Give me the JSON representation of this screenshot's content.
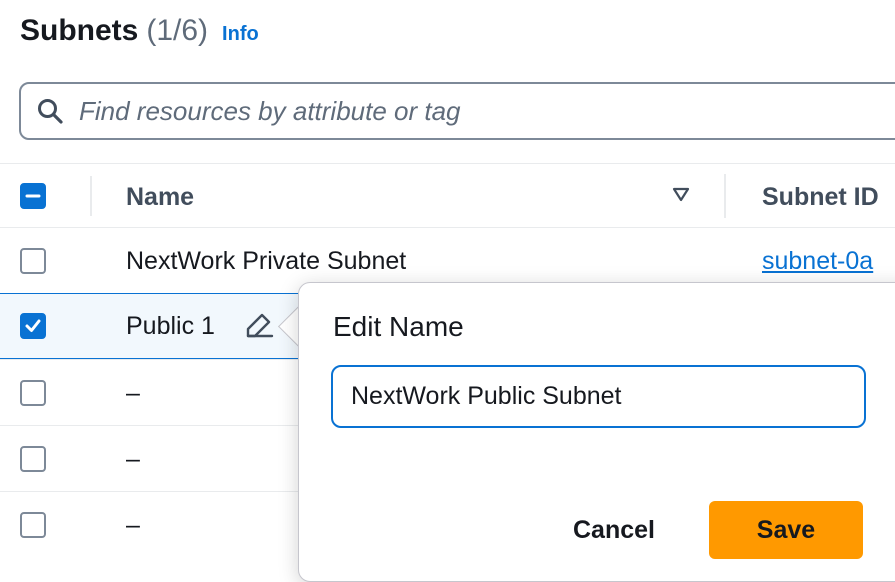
{
  "header": {
    "title": "Subnets",
    "count": "(1/6)",
    "info_link": "Info"
  },
  "search": {
    "placeholder": "Find resources by attribute or tag",
    "icon": "search-icon"
  },
  "table": {
    "columns": [
      "Name",
      "Subnet ID"
    ],
    "rows": [
      {
        "name": "NextWork Private Subnet",
        "subnet_id": "subnet-0a",
        "checked": false
      },
      {
        "name": "Public 1",
        "subnet_id": "",
        "checked": true
      },
      {
        "name": "–",
        "subnet_id": "",
        "checked": false
      },
      {
        "name": "–",
        "subnet_id": "",
        "checked": false
      },
      {
        "name": "–",
        "subnet_id": "",
        "checked": false
      }
    ]
  },
  "popover": {
    "title": "Edit Name",
    "input_value": "NextWork Public Subnet",
    "cancel_label": "Cancel",
    "save_label": "Save"
  },
  "colors": {
    "accent": "#0972d3",
    "primary_button": "#ff9900",
    "text": "#16191f"
  }
}
